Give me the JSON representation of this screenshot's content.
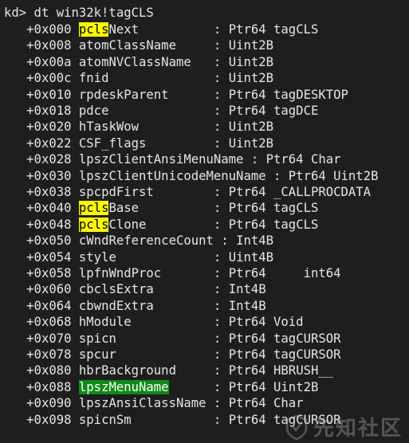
{
  "console": {
    "command_line": "kd> dt win32k!tagCLS",
    "fields": [
      {
        "offset": "+0x000",
        "highlight": "pcls",
        "highlight_color": "yellow",
        "name_rest": "Next",
        "pad": "          ",
        "type": "Ptr64 tagCLS"
      },
      {
        "offset": "+0x008",
        "highlight": "",
        "name_rest": "atomClassName",
        "pad": "     ",
        "type": "Uint2B"
      },
      {
        "offset": "+0x00a",
        "highlight": "",
        "name_rest": "atomNVClassName",
        "pad": "   ",
        "type": "Uint2B"
      },
      {
        "offset": "+0x00c",
        "highlight": "",
        "name_rest": "fnid",
        "pad": "              ",
        "type": "Uint2B"
      },
      {
        "offset": "+0x010",
        "highlight": "",
        "name_rest": "rpdeskParent",
        "pad": "      ",
        "type": "Ptr64 tagDESKTOP"
      },
      {
        "offset": "+0x018",
        "highlight": "",
        "name_rest": "pdce",
        "pad": "              ",
        "type": "Ptr64 tagDCE"
      },
      {
        "offset": "+0x020",
        "highlight": "",
        "name_rest": "hTaskWow",
        "pad": "          ",
        "type": "Uint2B"
      },
      {
        "offset": "+0x022",
        "highlight": "",
        "name_rest": "CSF_flags",
        "pad": "         ",
        "type": "Uint2B"
      },
      {
        "offset": "+0x028",
        "highlight": "",
        "name_rest": "lpszClientAnsiMenuName",
        "pad": " ",
        "type": "Ptr64 Char"
      },
      {
        "offset": "+0x030",
        "highlight": "",
        "name_rest": "lpszClientUnicodeMenuName",
        "pad": " ",
        "type": "Ptr64 Uint2B"
      },
      {
        "offset": "+0x038",
        "highlight": "",
        "name_rest": "spcpdFirst",
        "pad": "        ",
        "type": "Ptr64 _CALLPROCDATA"
      },
      {
        "offset": "+0x040",
        "highlight": "pcls",
        "highlight_color": "yellow",
        "name_rest": "Base",
        "pad": "          ",
        "type": "Ptr64 tagCLS"
      },
      {
        "offset": "+0x048",
        "highlight": "pcls",
        "highlight_color": "yellow",
        "name_rest": "Clone",
        "pad": "         ",
        "type": "Ptr64 tagCLS"
      },
      {
        "offset": "+0x050",
        "highlight": "",
        "name_rest": "cWndReferenceCount",
        "pad": " ",
        "type": "Int4B"
      },
      {
        "offset": "+0x054",
        "highlight": "",
        "name_rest": "style",
        "pad": "             ",
        "type": "Uint4B"
      },
      {
        "offset": "+0x058",
        "highlight": "",
        "name_rest": "lpfnWndProc",
        "pad": "       ",
        "type": "Ptr64     int64"
      },
      {
        "offset": "+0x060",
        "highlight": "",
        "name_rest": "cbclsExtra",
        "pad": "        ",
        "type": "Int4B"
      },
      {
        "offset": "+0x064",
        "highlight": "",
        "name_rest": "cbwndExtra",
        "pad": "        ",
        "type": "Int4B"
      },
      {
        "offset": "+0x068",
        "highlight": "",
        "name_rest": "hModule",
        "pad": "           ",
        "type": "Ptr64 Void"
      },
      {
        "offset": "+0x070",
        "highlight": "",
        "name_rest": "spicn",
        "pad": "             ",
        "type": "Ptr64 tagCURSOR"
      },
      {
        "offset": "+0x078",
        "highlight": "",
        "name_rest": "spcur",
        "pad": "             ",
        "type": "Ptr64 tagCURSOR"
      },
      {
        "offset": "+0x080",
        "highlight": "",
        "name_rest": "hbrBackground",
        "pad": "     ",
        "type": "Ptr64 HBRUSH__"
      },
      {
        "offset": "+0x088",
        "highlight": "lpszMenuName",
        "highlight_color": "green",
        "name_rest": "",
        "pad": "      ",
        "type": "Ptr64 Uint2B"
      },
      {
        "offset": "+0x090",
        "highlight": "",
        "name_rest": "lpszAnsiClassName",
        "pad": " ",
        "type": "Ptr64 Char"
      },
      {
        "offset": "+0x098",
        "highlight": "",
        "name_rest": "spicnSm",
        "pad": "           ",
        "type": "Ptr64 tagCURSOR"
      }
    ]
  },
  "watermark": {
    "text": "先知社区",
    "icon": "xianzhi-shield-logo"
  },
  "colors": {
    "background": "#1e1e1e",
    "foreground": "#e6e6e6",
    "highlight_yellow": "#ffff00",
    "highlight_green": "#0e8a16"
  }
}
